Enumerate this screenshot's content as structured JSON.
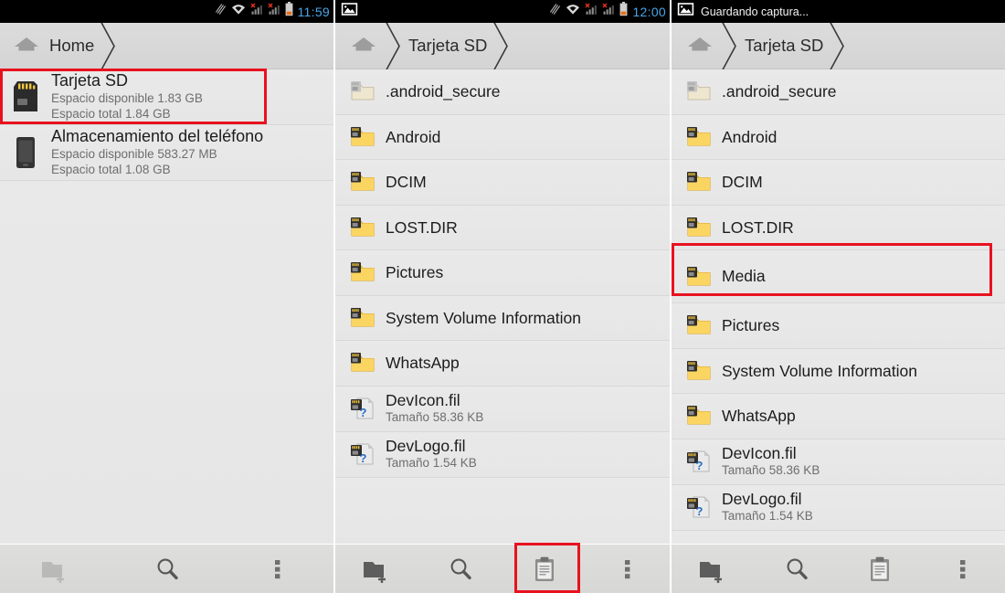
{
  "panels": [
    {
      "id": "panel-home",
      "statusbar": {
        "time": "11:59",
        "notification_text": "",
        "icons": [
          "vibrate-icon",
          "wifi-icon",
          "signal-no-sim-icon",
          "signal-no-sim-icon",
          "battery-icon"
        ]
      },
      "breadcrumb": [
        {
          "icon": "home-icon",
          "label": "Home"
        }
      ],
      "rows": [
        {
          "icon": "sd-card-icon",
          "name": "Tarjeta SD",
          "line2": "Espacio disponible 1.83 GB",
          "line3": "Espacio total 1.84 GB",
          "highlighted": true
        },
        {
          "icon": "phone-storage-icon",
          "name": "Almacenamiento del teléfono",
          "line2": "Espacio disponible 583.27 MB",
          "line3": "Espacio total 1.08 GB",
          "highlighted": false
        }
      ],
      "toolbar": [
        {
          "icon": "new-folder-icon",
          "label": "Nueva carpeta",
          "disabled": true,
          "highlighted": false
        },
        {
          "icon": "search-icon",
          "label": "Buscar",
          "disabled": false,
          "highlighted": false
        },
        {
          "icon": "overflow-menu-icon",
          "label": "Más opciones",
          "disabled": false,
          "highlighted": false
        }
      ]
    },
    {
      "id": "panel-sdcard-before-paste",
      "statusbar": {
        "time": "12:00",
        "notification_text": "",
        "icons": [
          "screenshot-image-icon",
          "vibrate-icon",
          "wifi-icon",
          "signal-no-sim-icon",
          "signal-no-sim-icon",
          "battery-icon"
        ]
      },
      "breadcrumb": [
        {
          "icon": "home-icon",
          "label": ""
        },
        {
          "icon": "",
          "label": "Tarjeta SD"
        }
      ],
      "rows": [
        {
          "icon": "folder-sd-disabled-icon",
          "name": ".android_secure",
          "line2": "",
          "line3": "",
          "highlighted": false
        },
        {
          "icon": "folder-sd-icon",
          "name": "Android",
          "line2": "",
          "line3": "",
          "highlighted": false
        },
        {
          "icon": "folder-sd-icon",
          "name": "DCIM",
          "line2": "",
          "line3": "",
          "highlighted": false
        },
        {
          "icon": "folder-sd-icon",
          "name": "LOST.DIR",
          "line2": "",
          "line3": "",
          "highlighted": false
        },
        {
          "icon": "folder-sd-icon",
          "name": "Pictures",
          "line2": "",
          "line3": "",
          "highlighted": false
        },
        {
          "icon": "folder-sd-icon",
          "name": "System Volume Information",
          "line2": "",
          "line3": "",
          "highlighted": false
        },
        {
          "icon": "folder-sd-icon",
          "name": "WhatsApp",
          "line2": "",
          "line3": "",
          "highlighted": false
        },
        {
          "icon": "file-unknown-sd-icon",
          "name": "DevIcon.fil",
          "line2": "Tamaño 58.36 KB",
          "line3": "",
          "highlighted": false
        },
        {
          "icon": "file-unknown-sd-icon",
          "name": "DevLogo.fil",
          "line2": "Tamaño 1.54 KB",
          "line3": "",
          "highlighted": false
        }
      ],
      "toolbar": [
        {
          "icon": "new-folder-icon",
          "label": "Nueva carpeta",
          "disabled": false,
          "highlighted": false
        },
        {
          "icon": "search-icon",
          "label": "Buscar",
          "disabled": false,
          "highlighted": false
        },
        {
          "icon": "clipboard-paste-icon",
          "label": "Pegar",
          "disabled": false,
          "highlighted": true
        },
        {
          "icon": "overflow-menu-icon",
          "label": "Más opciones",
          "disabled": false,
          "highlighted": false
        }
      ]
    },
    {
      "id": "panel-sdcard-after-paste",
      "statusbar": {
        "time": "",
        "notification_text": "Guardando captura...",
        "icons": [
          "screenshot-image-icon"
        ]
      },
      "breadcrumb": [
        {
          "icon": "home-icon",
          "label": ""
        },
        {
          "icon": "",
          "label": "Tarjeta SD"
        }
      ],
      "rows": [
        {
          "icon": "folder-sd-disabled-icon",
          "name": ".android_secure",
          "line2": "",
          "line3": "",
          "highlighted": false
        },
        {
          "icon": "folder-sd-icon",
          "name": "Android",
          "line2": "",
          "line3": "",
          "highlighted": false
        },
        {
          "icon": "folder-sd-icon",
          "name": "DCIM",
          "line2": "",
          "line3": "",
          "highlighted": false
        },
        {
          "icon": "folder-sd-icon",
          "name": "LOST.DIR",
          "line2": "",
          "line3": "",
          "highlighted": false
        },
        {
          "icon": "folder-sd-icon",
          "name": "Media",
          "line2": "",
          "line3": "",
          "highlighted": true
        },
        {
          "icon": "folder-sd-icon",
          "name": "Pictures",
          "line2": "",
          "line3": "",
          "highlighted": false
        },
        {
          "icon": "folder-sd-icon",
          "name": "System Volume Information",
          "line2": "",
          "line3": "",
          "highlighted": false
        },
        {
          "icon": "folder-sd-icon",
          "name": "WhatsApp",
          "line2": "",
          "line3": "",
          "highlighted": false
        },
        {
          "icon": "file-unknown-sd-icon",
          "name": "DevIcon.fil",
          "line2": "Tamaño 58.36 KB",
          "line3": "",
          "highlighted": false
        },
        {
          "icon": "file-unknown-sd-icon",
          "name": "DevLogo.fil",
          "line2": "Tamaño 1.54 KB",
          "line3": "",
          "highlighted": false
        }
      ],
      "toolbar": [
        {
          "icon": "new-folder-icon",
          "label": "Nueva carpeta",
          "disabled": false,
          "highlighted": false
        },
        {
          "icon": "search-icon",
          "label": "Buscar",
          "disabled": false,
          "highlighted": false
        },
        {
          "icon": "clipboard-paste-icon",
          "label": "Pegar",
          "disabled": false,
          "highlighted": false
        },
        {
          "icon": "overflow-menu-icon",
          "label": "Más opciones",
          "disabled": false,
          "highlighted": false
        }
      ]
    }
  ],
  "colors": {
    "annotation_red": "#e8121f",
    "statusbar_bg": "#000000",
    "clock_blue": "#49a5e8",
    "folder_yellow": "#f7c13c",
    "list_bg": "#e8e8e8",
    "bar_bg": "#d7d7d7"
  }
}
